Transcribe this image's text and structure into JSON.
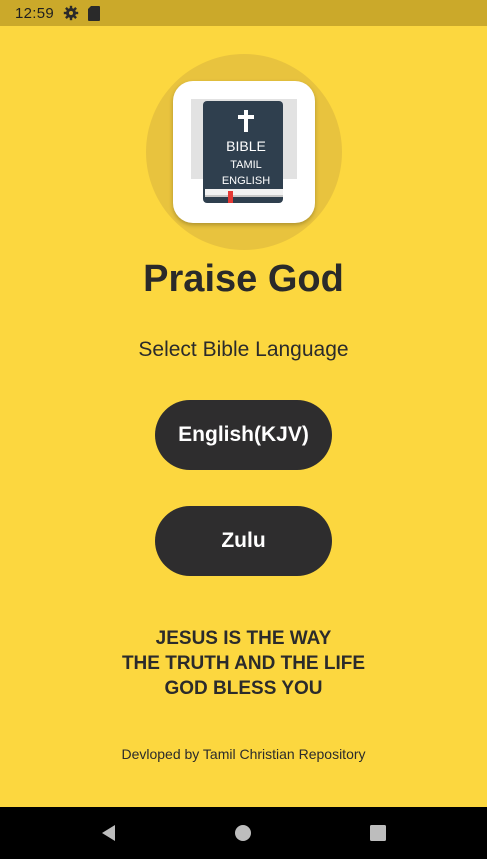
{
  "status_bar": {
    "time": "12:59",
    "icons": [
      "gear-icon",
      "sd-card-icon"
    ]
  },
  "logo": {
    "line1": "BIBLE",
    "line2": "TAMIL",
    "line3": "ENGLISH"
  },
  "app_title": "Praise God",
  "subtitle": "Select Bible Language",
  "buttons": {
    "english": "English(KJV)",
    "zulu": "Zulu"
  },
  "tagline": {
    "line1": "JESUS IS THE WAY",
    "line2": "THE TRUTH AND THE LIFE",
    "line3": "GOD BLESS YOU"
  },
  "footer": "Devloped by Tamil Christian Repository",
  "nav_bar": {
    "icons": [
      "back-icon",
      "home-icon",
      "recents-icon"
    ]
  },
  "colors": {
    "background": "#FCD73F",
    "status_bar": "#CBA92A",
    "button": "#2E2D2E",
    "button_text": "#FFFFFF",
    "text": "#2B2B2B"
  }
}
